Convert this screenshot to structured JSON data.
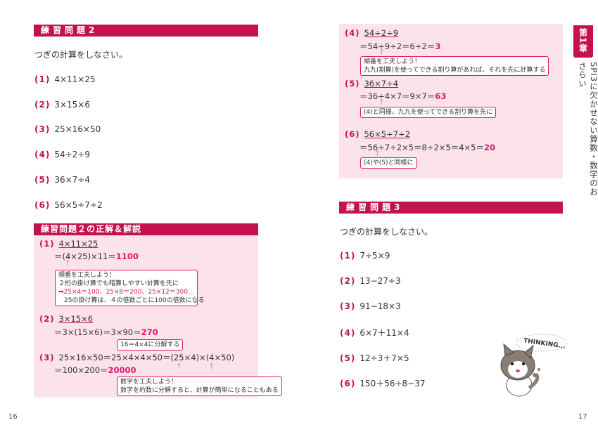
{
  "left": {
    "practice_header": "練習問題2",
    "intro": "つぎの計算をしなさい。",
    "questions": [
      {
        "num": "(1)",
        "expr": "4×11×25"
      },
      {
        "num": "(2)",
        "expr": "3×15×6"
      },
      {
        "num": "(3)",
        "expr": "25×16×50"
      },
      {
        "num": "(4)",
        "expr": "54÷2÷9"
      },
      {
        "num": "(5)",
        "expr": "36×7÷4"
      },
      {
        "num": "(6)",
        "expr": "56×5÷7÷2"
      }
    ],
    "answer_header": "練習問題２の正解＆解説",
    "a1": {
      "num": "(1)",
      "line1": "4×11×25",
      "line2_pre": "＝(4×25)×11＝",
      "ans": "1100"
    },
    "note1": {
      "l1": "順番を工夫しよう！",
      "l2": "２桁の掛け算でも暗算しやすい計算を先に",
      "l3": "➡25×4＝100、25×8＝200、25×12＝300…",
      "l4": "25の掛け算は、４の倍数ごとに100の倍数になる"
    },
    "a2": {
      "num": "(2)",
      "line1": "3×15×6",
      "line2_pre": "＝3×(15×6)＝3×90＝",
      "ans": "270"
    },
    "note2": "16＝4×4に分解する",
    "a3": {
      "num": "(3)",
      "line1": "25×16×50＝25×4×4×50＝(25×4)×(4×50)",
      "line2_pre": "＝100×200＝",
      "ans": "20000"
    },
    "note3": {
      "l1": "数字を工夫しよう！",
      "l2": "数字を約数に分解すると、計算が簡単になることもある"
    },
    "page_number": "16"
  },
  "right": {
    "a4": {
      "num": "(4)",
      "line1": "54÷2÷9",
      "line2_pre": "＝54÷9÷2＝6÷2＝",
      "ans": "3"
    },
    "note4": {
      "l1": "順番を工夫しよう！",
      "l2": "九九(割算)を使ってできる割り算があれば、それを先に計算する"
    },
    "a5": {
      "num": "(5)",
      "line1": "36×7÷4",
      "line2_pre": "＝36÷4×7＝9×7＝",
      "ans": "63"
    },
    "note5": "(4)と同様、九九を使ってできる割り算を先に",
    "a6": {
      "num": "(6)",
      "line1": "56×5÷7÷2",
      "line2_pre": "＝56÷7÷2×5＝8÷2×5＝4×5＝",
      "ans": "20"
    },
    "note6": "(4)や(5)と同様に",
    "practice_header": "練習問題3",
    "intro": "つぎの計算をしなさい。",
    "questions": [
      {
        "num": "(1)",
        "expr": "7÷5×9"
      },
      {
        "num": "(2)",
        "expr": "13−27÷3"
      },
      {
        "num": "(3)",
        "expr": "91−18×3"
      },
      {
        "num": "(4)",
        "expr": "6×7＋11×4"
      },
      {
        "num": "(5)",
        "expr": "12÷3＋7×5"
      },
      {
        "num": "(6)",
        "expr": "150＋56÷8−37"
      }
    ],
    "thinking": "THINKING...",
    "page_number": "17"
  },
  "chapter_tab": "第1章",
  "chapter_title": "SPI3に欠かせない算数・数学のおさらい",
  "colors": {
    "accent": "#c4124f",
    "answer": "#e3156b",
    "panel": "#fbe3e9"
  }
}
